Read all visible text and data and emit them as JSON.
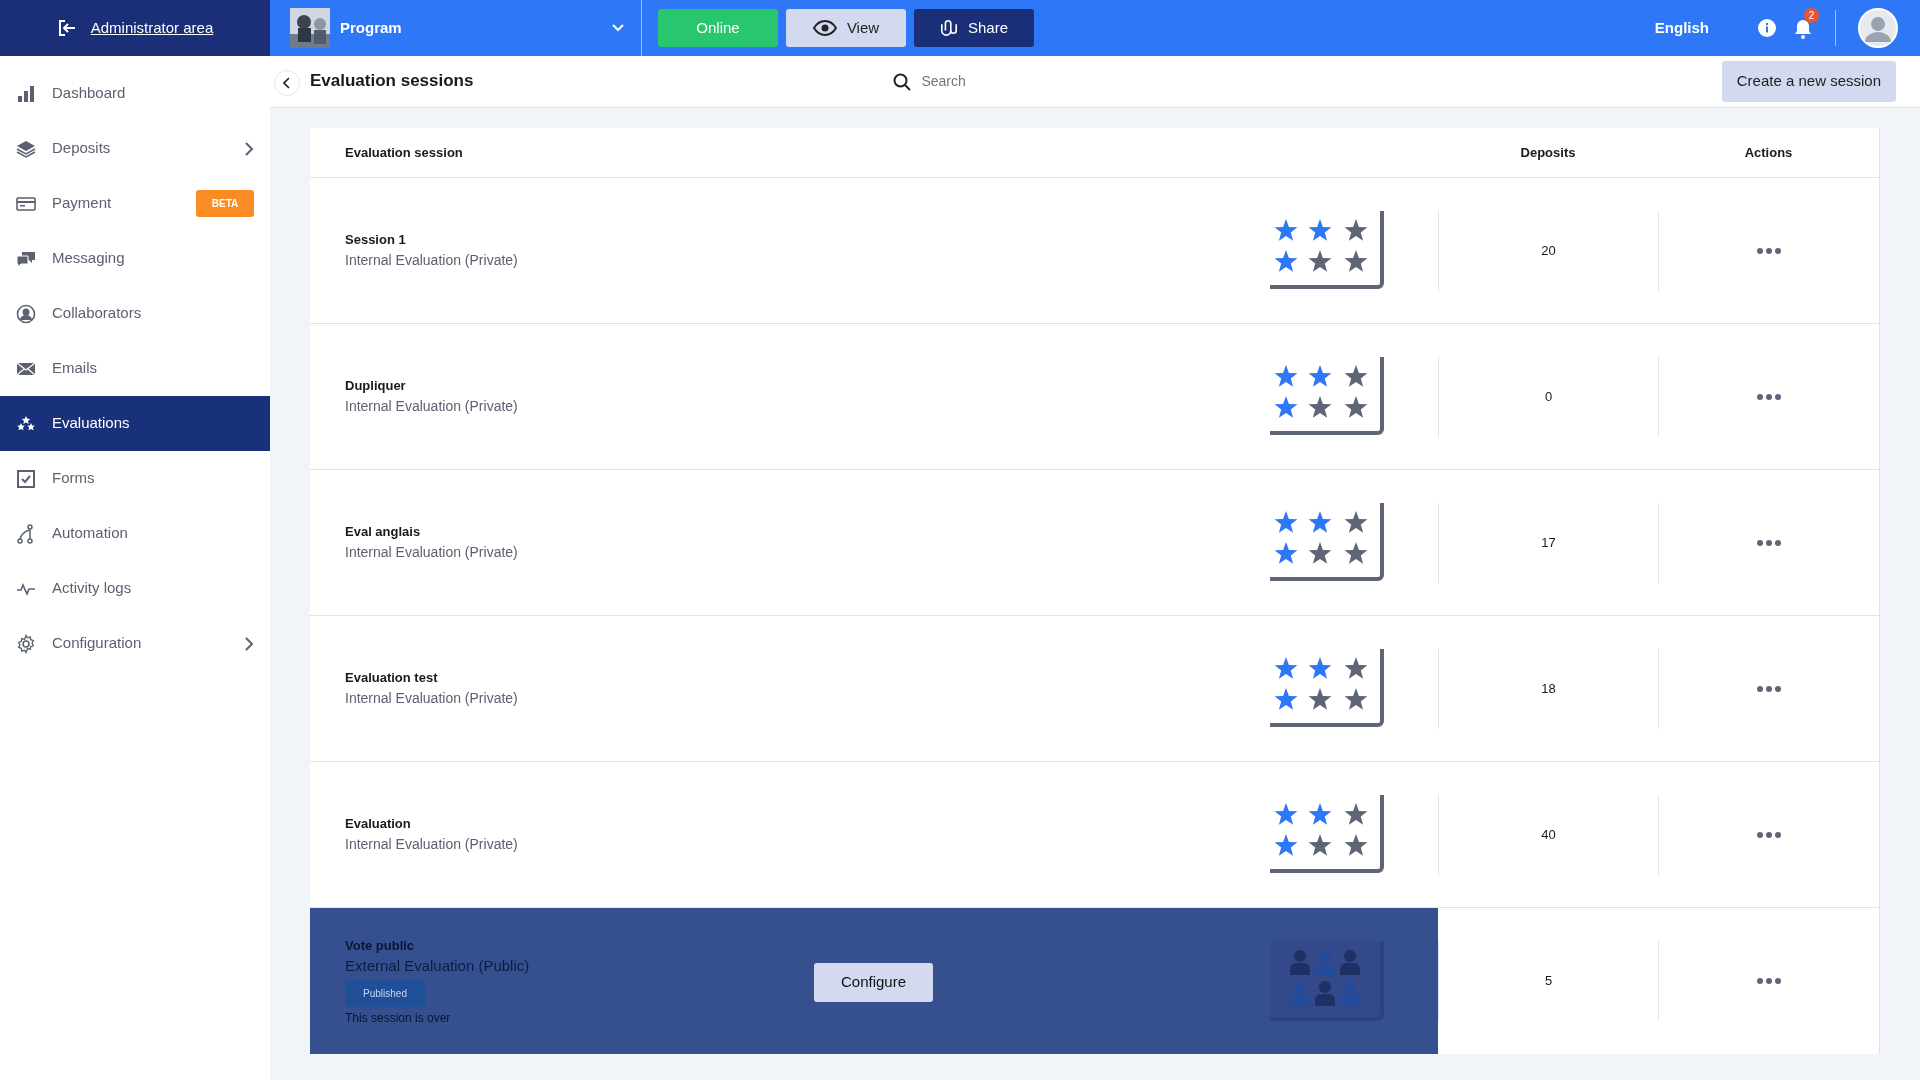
{
  "topbar": {
    "admin_label": "Administrator area",
    "program": "Program",
    "buttons": [
      {
        "label": "Online",
        "kind": "online"
      },
      {
        "label": "View",
        "kind": "view"
      },
      {
        "label": "Share",
        "kind": "share"
      }
    ],
    "language": "English",
    "notifications": "2"
  },
  "sidebar": {
    "items": [
      {
        "label": "Dashboard",
        "selected": false,
        "submenu": false
      },
      {
        "label": "Deposits",
        "selected": false,
        "submenu": true
      },
      {
        "label": "Payment",
        "selected": false,
        "submenu": false,
        "badge": "BETA"
      },
      {
        "label": "Messaging",
        "selected": false,
        "submenu": false
      },
      {
        "label": "Collaborators",
        "selected": false,
        "submenu": false
      },
      {
        "label": "Emails",
        "selected": false,
        "submenu": false
      },
      {
        "label": "Evaluations",
        "selected": true,
        "submenu": false
      },
      {
        "label": "Forms",
        "selected": false,
        "submenu": false
      },
      {
        "label": "Automation",
        "selected": false,
        "submenu": false
      },
      {
        "label": "Activity logs",
        "selected": false,
        "submenu": false
      },
      {
        "label": "Configuration",
        "selected": false,
        "submenu": true
      }
    ]
  },
  "page": {
    "title": "Evaluation sessions",
    "search": {
      "placeholder": "Search"
    },
    "create_button": "Create a new session"
  },
  "table": {
    "columns": [
      "Evaluation session",
      "Deposits",
      "Actions"
    ],
    "rows": [
      {
        "name": "Session 1",
        "subtitle": "Internal Evaluation (Private)",
        "deposits": "20",
        "kind": "private"
      },
      {
        "name": "Dupliquer",
        "subtitle": "Internal Evaluation (Private)",
        "deposits": "0",
        "kind": "private"
      },
      {
        "name": "Eval anglais",
        "subtitle": "Internal Evaluation (Private)",
        "deposits": "17",
        "kind": "private"
      },
      {
        "name": "Evaluation test",
        "subtitle": "Internal Evaluation (Private)",
        "deposits": "18",
        "kind": "private"
      },
      {
        "name": "Evaluation",
        "subtitle": "Internal Evaluation (Private)",
        "deposits": "40",
        "kind": "private"
      },
      {
        "name": "Vote public",
        "subtitle": "External Evaluation (Public)",
        "deposits": "5",
        "kind": "public",
        "status": "Published",
        "note": "This session is over",
        "action": "Configure"
      }
    ]
  }
}
